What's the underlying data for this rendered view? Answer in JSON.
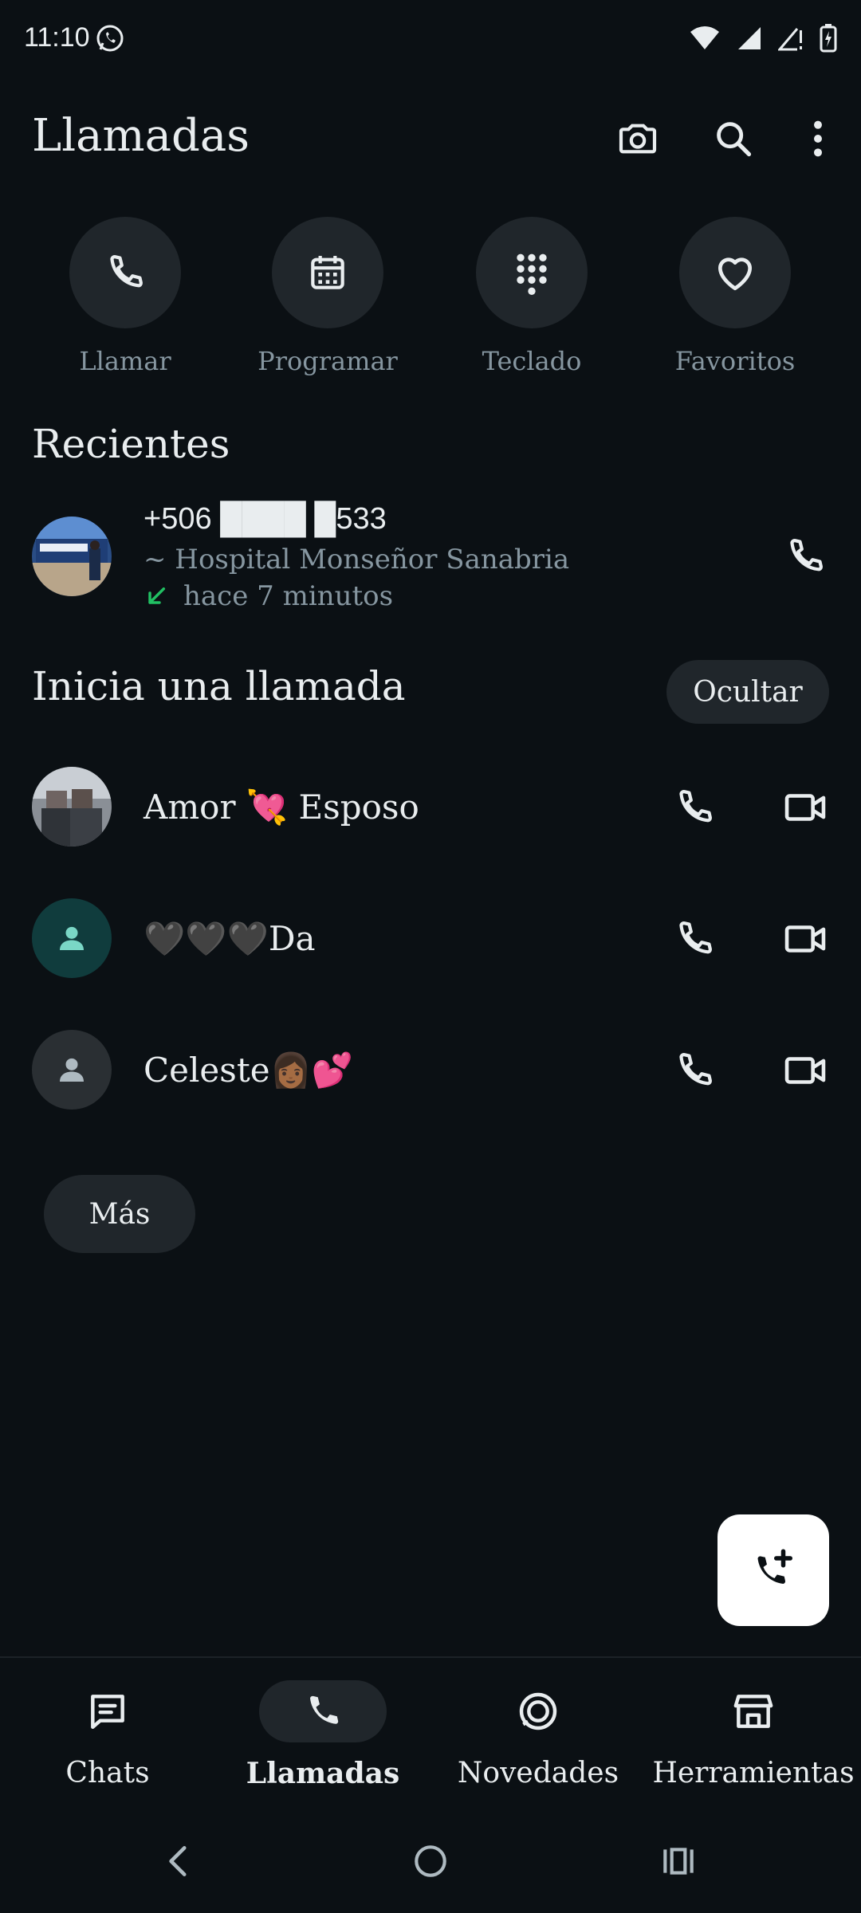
{
  "status_bar": {
    "time": "11:10"
  },
  "header": {
    "title": "Llamadas"
  },
  "quick_actions": [
    {
      "label": "Llamar",
      "icon": "phone-icon"
    },
    {
      "label": "Programar",
      "icon": "calendar-icon"
    },
    {
      "label": "Teclado",
      "icon": "dialpad-icon"
    },
    {
      "label": "Favoritos",
      "icon": "heart-icon"
    }
  ],
  "recents": {
    "title": "Recientes",
    "items": [
      {
        "number": "+506 ████ █533",
        "name": "~ Hospital Monseñor Sanabria",
        "time": "hace 7 minutos",
        "direction": "incoming"
      }
    ]
  },
  "start_call": {
    "title": "Inicia una llamada",
    "hide_label": "Ocultar",
    "contacts": [
      {
        "name": "Amor 💘 Esposo"
      },
      {
        "name": "🖤🖤🖤Da"
      },
      {
        "name": "Celeste👩🏾💕"
      }
    ],
    "more_label": "Más"
  },
  "bottom_nav": [
    {
      "label": "Chats",
      "active": false
    },
    {
      "label": "Llamadas",
      "active": true
    },
    {
      "label": "Novedades",
      "active": false
    },
    {
      "label": "Herramientas",
      "active": false
    }
  ],
  "colors": {
    "background": "#0b1014",
    "surface": "#20262b",
    "text": "#e9edef",
    "muted": "#8696a0",
    "accent_green": "#21c063",
    "avatar_teal": "#103c3d"
  }
}
